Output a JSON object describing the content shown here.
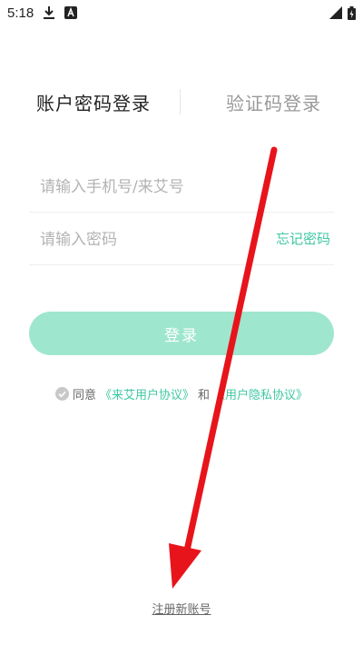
{
  "status_bar": {
    "time": "5:18",
    "icons": [
      "download-icon",
      "notification-a-icon",
      "signal-icon",
      "battery-icon"
    ]
  },
  "tabs": {
    "password_login": "账户密码登录",
    "code_login": "验证码登录"
  },
  "form": {
    "phone_placeholder": "请输入手机号/来艾号",
    "password_placeholder": "请输入密码",
    "forgot_password": "忘记密码",
    "login_button": "登录"
  },
  "agreement": {
    "prefix": "同意",
    "user_agreement": "《来艾用户协议》",
    "and": "和",
    "privacy_policy": "《用户隐私协议》"
  },
  "register_link": "注册新账号",
  "colors": {
    "accent": "#3fc8a2",
    "button_bg": "#9fe6cf",
    "annotation_arrow": "#e8141b"
  }
}
